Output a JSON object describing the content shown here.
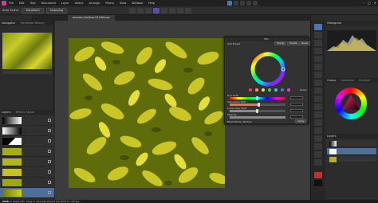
{
  "menubar": {
    "items": [
      "File",
      "Edit",
      "Text",
      "Document",
      "Layer",
      "Select",
      "Arrange",
      "Filters",
      "View",
      "Window",
      "Help"
    ]
  },
  "toolbar": {
    "label": "Auto Select:",
    "button": "Transform",
    "button2": "Snapping"
  },
  "document_tab": "autumn-bushes.tif (Yellow)",
  "navigator": {
    "title": "Navigator",
    "other": "Transform  History"
  },
  "layers": {
    "title": "Layers",
    "other": "Effects  Styles"
  },
  "hue_dialog": {
    "title": "HSL",
    "preset_label": "Add Preset",
    "merge": "Merge",
    "delete": "Delete",
    "reset": "Reset",
    "labels": [
      "Hue Shift",
      "Saturation Shift",
      "Luminosity Shift"
    ],
    "picker": "Picker",
    "opacity_label": "Opacity",
    "blend_label": "Blend Mode: Normal",
    "action": "Apply"
  },
  "right_panel": {
    "histogram_title": "Histogram",
    "color_title": "Colour",
    "swatches_title": "Swatches",
    "brushes_title": "Brushes",
    "layers_title": "Layers"
  },
  "statusbar": {
    "bold": "Click",
    "text": " to Reset HSL. Drag to add adjustment and Shift to change."
  },
  "colors": {
    "accent": "#4a76b8",
    "brand": "#d53a9d"
  }
}
